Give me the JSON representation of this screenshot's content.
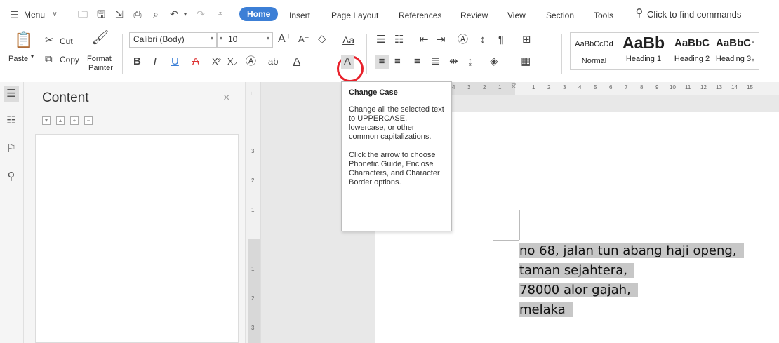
{
  "menubar": {
    "menu_label": "Menu",
    "tabs": [
      {
        "label": "Home",
        "active": true
      },
      {
        "label": "Insert"
      },
      {
        "label": "Page Layout"
      },
      {
        "label": "References"
      },
      {
        "label": "Review"
      },
      {
        "label": "View"
      },
      {
        "label": "Section"
      },
      {
        "label": "Tools"
      }
    ],
    "search_placeholder": "Click to find commands"
  },
  "ribbon": {
    "paste_label": "Paste",
    "cut_label": "Cut",
    "copy_label": "Copy",
    "format_painter_label_1": "Format",
    "format_painter_label_2": "Painter",
    "font_name": "Calibri (Body)",
    "font_size": "10",
    "styles": [
      {
        "sample": "AaBbCcDd",
        "name": "Normal"
      },
      {
        "sample": "AaBb",
        "name": "Heading 1"
      },
      {
        "sample": "AaBbC",
        "name": "Heading 2"
      },
      {
        "sample": "AaBbC",
        "name": "Heading 3"
      }
    ]
  },
  "content_panel": {
    "title": "Content",
    "close_glyph": "×"
  },
  "hruler": {
    "ticks": [
      "4",
      "3",
      "2",
      "1",
      "1",
      "2",
      "3",
      "4",
      "5",
      "6",
      "7",
      "8",
      "9",
      "10",
      "11",
      "12",
      "13",
      "14",
      "15"
    ]
  },
  "vruler": {
    "ticks": [
      "3",
      "2",
      "1",
      "1",
      "2",
      "3"
    ]
  },
  "tooltip": {
    "title": "Change Case",
    "para1": "Change all the selected text to UPPERCASE, lowercase, or other common capitalizations.",
    "para2": "Click the arrow to choose Phonetic Guide, Enclose Characters, and Character Border options."
  },
  "document": {
    "lines": [
      "no 68, jalan tun abang haji openg,",
      "taman sejahtera,",
      "78000 alor gajah,",
      "melaka"
    ]
  },
  "colors": {
    "accent": "#3c7fd6",
    "highlight_ring": "#e8212b",
    "selection": "#c7c7c7"
  }
}
